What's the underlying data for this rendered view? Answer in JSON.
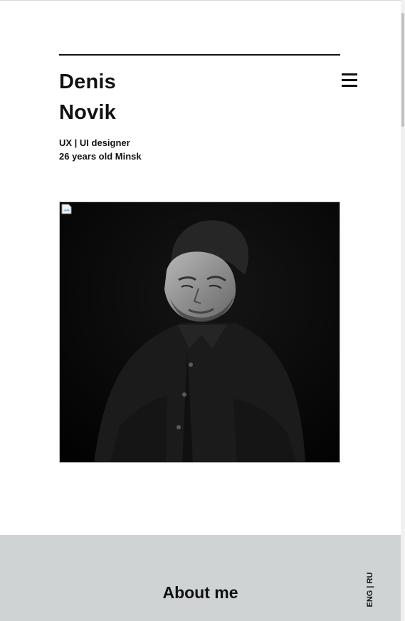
{
  "header": {
    "first_name": "Denis",
    "last_name": "Novik",
    "role": "UX | UI designer",
    "details": "26 years old Minsk"
  },
  "menu": {
    "icon": "hamburger-menu-icon"
  },
  "hero": {
    "image_icon": "broken-image-icon"
  },
  "about": {
    "title": "About me"
  },
  "language": {
    "label": "ENG | RU"
  },
  "colors": {
    "text": "#111111",
    "about_background": "#cfd3d4",
    "photo_background": "#050505"
  }
}
